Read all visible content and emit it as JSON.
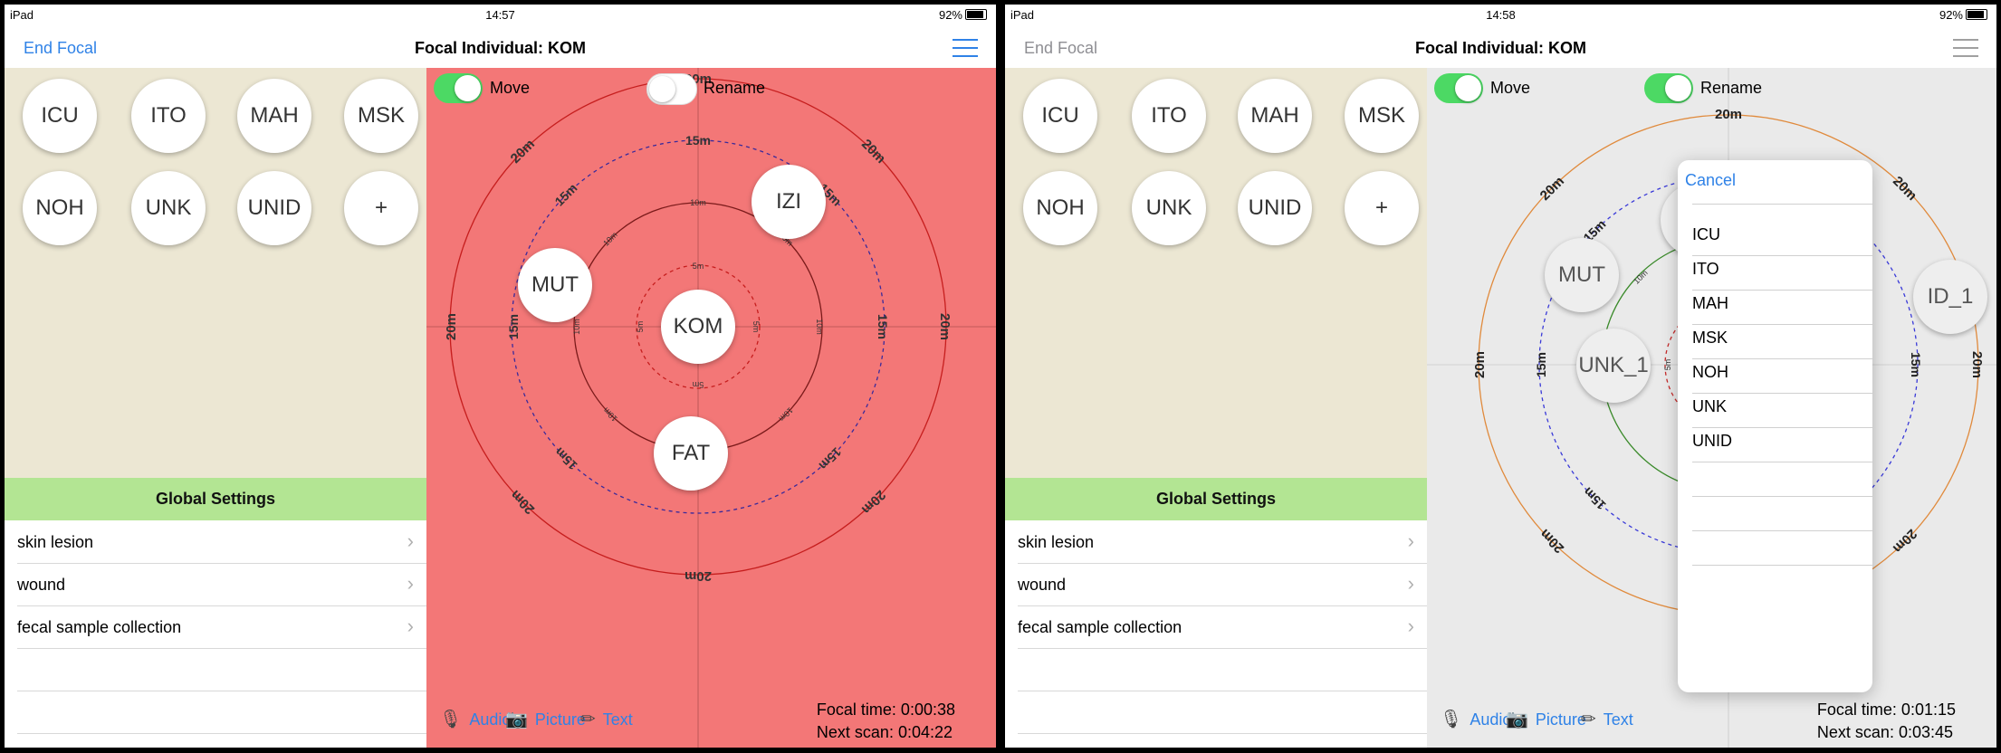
{
  "screen1": {
    "status": {
      "device": "iPad",
      "time": "14:57",
      "battery": "92%"
    },
    "nav": {
      "left": "End Focal",
      "title": "Focal Individual: KOM"
    },
    "chips": [
      "ICU",
      "ITO",
      "MAH",
      "MSK",
      "NOH",
      "UNK",
      "UNID",
      "+"
    ],
    "global_settings": "Global Settings",
    "settings": [
      "skin lesion",
      "wound",
      "fecal sample collection"
    ],
    "toggles": {
      "move": "Move",
      "rename": "Rename",
      "move_on": true,
      "rename_on": false
    },
    "rings": {
      "r5": "5m",
      "r10": "10m",
      "r15": "15m",
      "r20": "20m"
    },
    "center": "KOM",
    "individuals": [
      "IZI",
      "MUT",
      "FAT"
    ],
    "bottom": {
      "audio": "Audio",
      "picture": "Picture",
      "text": "Text"
    },
    "times": {
      "focal": "Focal time: 0:00:38",
      "scan": "Next scan: 0:04:22"
    }
  },
  "screen2": {
    "status": {
      "device": "iPad",
      "time": "14:58",
      "battery": "92%"
    },
    "nav": {
      "left": "End Focal",
      "title": "Focal Individual: KOM"
    },
    "chips": [
      "ICU",
      "ITO",
      "MAH",
      "MSK",
      "NOH",
      "UNK",
      "UNID",
      "+"
    ],
    "global_settings": "Global Settings",
    "settings": [
      "skin lesion",
      "wound",
      "fecal sample collection"
    ],
    "toggles": {
      "move": "Move",
      "rename": "Rename",
      "move_on": true,
      "rename_on": true
    },
    "rings": {
      "r5": "5m",
      "r10": "10m",
      "r15": "15m",
      "r20": "20m"
    },
    "individuals": [
      "MUT",
      "UNK_1",
      "ID_1",
      "U"
    ],
    "popover": {
      "cancel": "Cancel",
      "options": [
        "ICU",
        "ITO",
        "MAH",
        "MSK",
        "NOH",
        "UNK",
        "UNID"
      ]
    },
    "bottom": {
      "audio": "Audio",
      "picture": "Picture",
      "text": "Text"
    },
    "times": {
      "focal": "Focal time: 0:01:15",
      "scan": "Next scan: 0:03:45"
    }
  },
  "colors": {
    "accent": "#2f82e7",
    "map_active": "#f37777",
    "green": "#b3e593",
    "toggle_on": "#4cd964",
    "panel": "#ece7d3"
  },
  "icons": {
    "audio": "microphone-icon",
    "picture": "camera-icon",
    "text": "pencil-icon",
    "menu": "hamburger-icon"
  }
}
